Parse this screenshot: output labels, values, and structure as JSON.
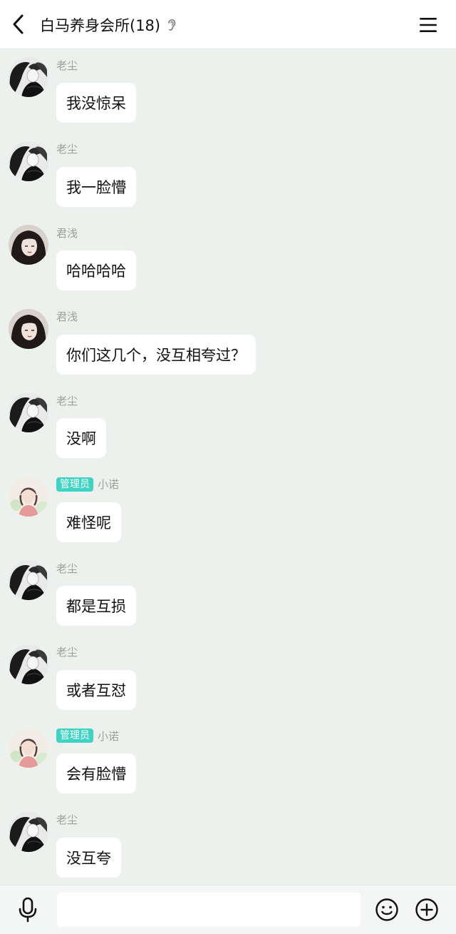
{
  "header": {
    "title": "白马养身会所(18)",
    "back_icon": "chevron-left-icon",
    "ear_icon": "ear-icon",
    "menu_icon": "menu-icon"
  },
  "messages": [
    {
      "sender": "老尘",
      "avatar": "avatar-laochen",
      "badge": "",
      "text": "我没惊呆"
    },
    {
      "sender": "老尘",
      "avatar": "avatar-laochen",
      "badge": "",
      "text": "我一脸懵"
    },
    {
      "sender": "君浅",
      "avatar": "avatar-junqian",
      "badge": "",
      "text": "哈哈哈哈"
    },
    {
      "sender": "君浅",
      "avatar": "avatar-junqian",
      "badge": "",
      "text": "你们这几个，没互相夸过？"
    },
    {
      "sender": "老尘",
      "avatar": "avatar-laochen",
      "badge": "",
      "text": "没啊"
    },
    {
      "sender": "小诺",
      "avatar": "avatar-xiaonuo",
      "badge": "管理员",
      "text": "难怪呢"
    },
    {
      "sender": "老尘",
      "avatar": "avatar-laochen",
      "badge": "",
      "text": "都是互损"
    },
    {
      "sender": "老尘",
      "avatar": "avatar-laochen",
      "badge": "",
      "text": "或者互怼"
    },
    {
      "sender": "小诺",
      "avatar": "avatar-xiaonuo",
      "badge": "管理员",
      "text": "会有脸懵"
    },
    {
      "sender": "老尘",
      "avatar": "avatar-laochen",
      "badge": "",
      "text": "没互夸"
    }
  ],
  "input": {
    "value": "",
    "placeholder": "",
    "mic_icon": "microphone-icon",
    "emoji_icon": "smiley-icon",
    "plus_icon": "plus-circle-icon"
  },
  "colors": {
    "chat_bg": "#edf1ee",
    "bubble_bg": "#ffffff",
    "badge_bg": "#3fd3c4",
    "name_text": "#9aa09c"
  }
}
